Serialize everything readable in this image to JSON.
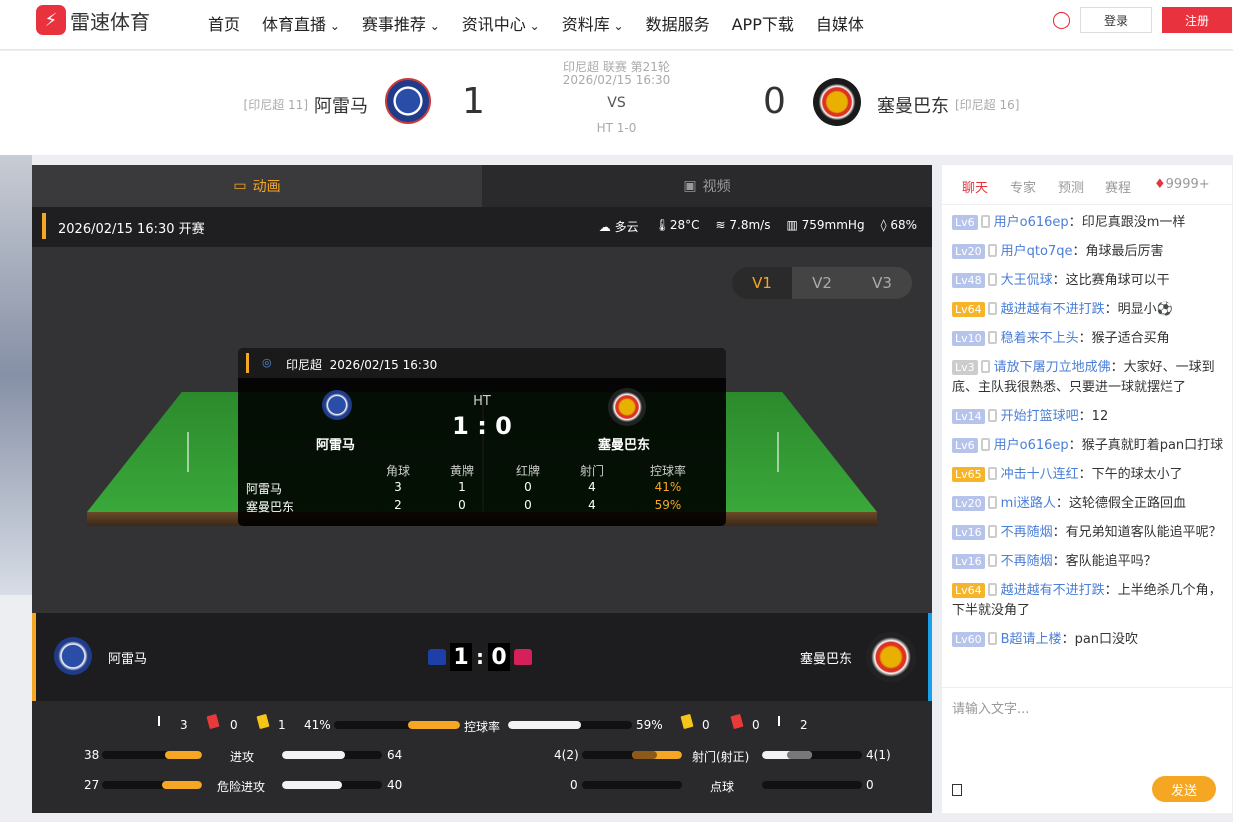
{
  "nav": {
    "logo_text": "雷速体育",
    "menu": [
      "首页",
      "体育直播",
      "赛事推荐",
      "资讯中心",
      "资料库",
      "数据服务",
      "APP下载",
      "自媒体"
    ],
    "menu_dropdown": [
      false,
      true,
      true,
      true,
      true,
      false,
      false,
      false
    ],
    "login": "登录",
    "register": "注册"
  },
  "match": {
    "league": "印尼超 联赛 第21轮",
    "datetime": "2026/02/15 16:30",
    "vs": "VS",
    "ht": "HT 1-0",
    "home": {
      "name": "阿雷马",
      "rank": "[印尼超 11]",
      "score": "1"
    },
    "away": {
      "name": "塞曼巴东",
      "rank": "[印尼超 16]",
      "score": "0"
    }
  },
  "tabs": {
    "animation": "动画",
    "video": "视频"
  },
  "infobar": {
    "datetime_status": "2026/02/15 16:30 开赛",
    "weather": "多云",
    "temp": "28°C",
    "wind": "7.8m/s",
    "pressure": "759mmHg",
    "humidity": "68%"
  },
  "versions": [
    "V1",
    "V2",
    "V3"
  ],
  "overlay": {
    "league_short": "印尼超",
    "datetime": "2026/02/15 16:30",
    "half": "HT",
    "score": "1 : 0",
    "home": "阿雷马",
    "away": "塞曼巴东",
    "headers": [
      "角球",
      "黄牌",
      "红牌",
      "射门",
      "控球率"
    ],
    "rows": [
      {
        "team": "阿雷马",
        "values": [
          "3",
          "1",
          "0",
          "4",
          "41%"
        ]
      },
      {
        "team": "塞曼巴东",
        "values": [
          "2",
          "0",
          "0",
          "4",
          "59%"
        ]
      }
    ]
  },
  "scorebar": {
    "home": "阿雷马",
    "away": "塞曼巴东",
    "home_score": "1",
    "away_score": "0",
    "colon": ":"
  },
  "stats": {
    "home_corner": "3",
    "home_red": "0",
    "home_yellow": "1",
    "away_yellow": "0",
    "away_red": "0",
    "away_corner": "2",
    "possession": {
      "label": "控球率",
      "home": "41%",
      "away": "59%",
      "home_pct": 41,
      "away_pct": 59
    },
    "attack": {
      "label": "进攻",
      "home": "38",
      "away": "64"
    },
    "danger": {
      "label": "危险进攻",
      "home": "27",
      "away": "40"
    },
    "shots": {
      "label": "射门(射正)",
      "home": "4(2)",
      "away": "4(1)"
    },
    "penalty": {
      "label": "点球",
      "home": "0",
      "away": "0"
    }
  },
  "chat": {
    "tabs": [
      "聊天",
      "专家",
      "预测",
      "赛程"
    ],
    "online": "9999+",
    "messages": [
      {
        "lv": "Lv6",
        "color": "b",
        "user": "用户o616ep",
        "text": "印尼真跟没m一样"
      },
      {
        "lv": "Lv20",
        "color": "b",
        "user": "用户qto7qe",
        "text": "角球最后厉害"
      },
      {
        "lv": "Lv48",
        "color": "b",
        "user": "大王侃球",
        "text": "这比赛角球可以干"
      },
      {
        "lv": "Lv64",
        "color": "o",
        "user": "越进越有不进打跌",
        "text": "明显小⚽"
      },
      {
        "lv": "Lv10",
        "color": "b",
        "user": "稳着来不上头",
        "text": "猴子适合买角"
      },
      {
        "lv": "Lv3",
        "color": "g",
        "user": "请放下屠刀立地成佛",
        "text": "大家好、一球到底、主队我很熟悉、只要进一球就摆烂了"
      },
      {
        "lv": "Lv14",
        "color": "b",
        "user": "开始打篮球吧",
        "text": "12"
      },
      {
        "lv": "Lv6",
        "color": "b",
        "user": "用户o616ep",
        "text": "猴子真就盯着pan口打球"
      },
      {
        "lv": "Lv65",
        "color": "o",
        "user": "冲击十八连红",
        "text": "下午的球太小了"
      },
      {
        "lv": "Lv20",
        "color": "b",
        "user": "mi迷路人",
        "text": "这轮德假全正路回血"
      },
      {
        "lv": "Lv16",
        "color": "b",
        "user": "不再随烟",
        "text": "有兄弟知道客队能追平呢？"
      },
      {
        "lv": "Lv16",
        "color": "b",
        "user": "不再随烟",
        "text": "客队能追平吗？"
      },
      {
        "lv": "Lv64",
        "color": "o",
        "user": "越进越有不进打跌",
        "text": "上半绝杀几个角，下半就没角了"
      },
      {
        "lv": "Lv60",
        "color": "b",
        "user": "B超请上楼",
        "text": "pan口没吹"
      }
    ],
    "input_placeholder": "请输入文字...",
    "send": "发送"
  }
}
